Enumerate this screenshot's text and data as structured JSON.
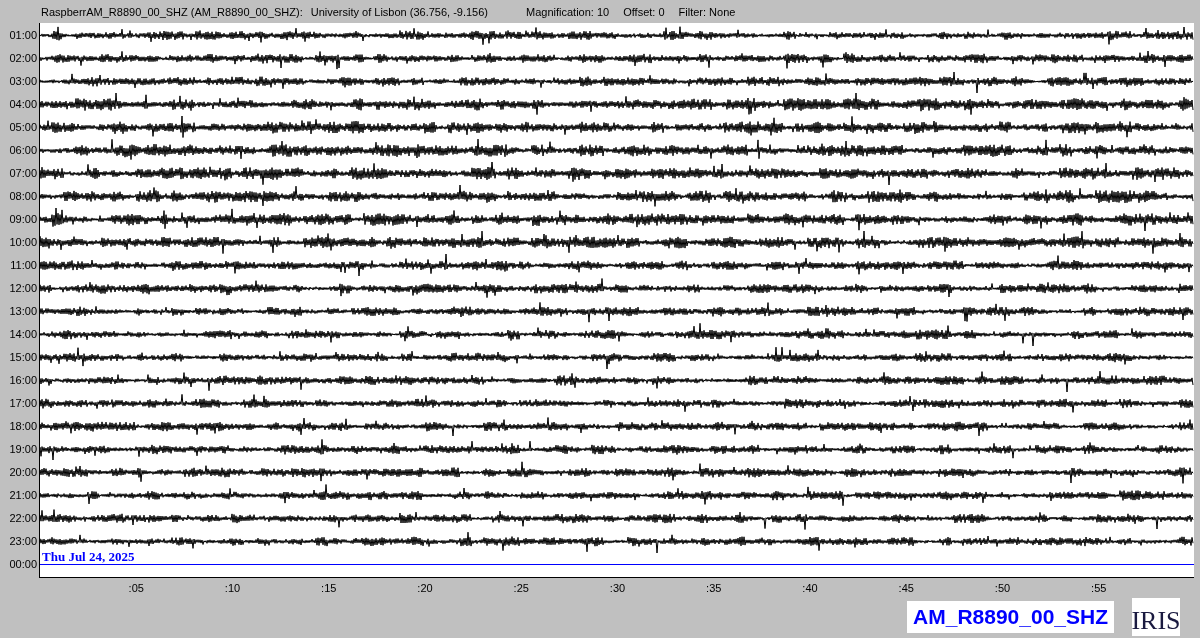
{
  "header": {
    "station": "RaspberrAM_R8890_00_SHZ (AM_R8890_00_SHZ):",
    "location": "University of Lisbon (36.756, -9.156)",
    "magnification": "Magnification: 10",
    "offset": "Offset: 0",
    "filter": "Filter: None"
  },
  "rows": [
    {
      "label": "01:00",
      "kind": "trace"
    },
    {
      "label": "02:00",
      "kind": "trace"
    },
    {
      "label": "03:00",
      "kind": "trace"
    },
    {
      "label": "04:00",
      "kind": "trace"
    },
    {
      "label": "05:00",
      "kind": "trace"
    },
    {
      "label": "06:00",
      "kind": "trace"
    },
    {
      "label": "07:00",
      "kind": "trace"
    },
    {
      "label": "08:00",
      "kind": "trace"
    },
    {
      "label": "09:00",
      "kind": "trace"
    },
    {
      "label": "10:00",
      "kind": "trace"
    },
    {
      "label": "11:00",
      "kind": "trace"
    },
    {
      "label": "12:00",
      "kind": "trace"
    },
    {
      "label": "13:00",
      "kind": "trace"
    },
    {
      "label": "14:00",
      "kind": "trace"
    },
    {
      "label": "15:00",
      "kind": "trace"
    },
    {
      "label": "16:00",
      "kind": "trace"
    },
    {
      "label": "17:00",
      "kind": "trace"
    },
    {
      "label": "18:00",
      "kind": "trace"
    },
    {
      "label": "19:00",
      "kind": "trace"
    },
    {
      "label": "20:00",
      "kind": "trace"
    },
    {
      "label": "21:00",
      "kind": "trace"
    },
    {
      "label": "22:00",
      "kind": "trace"
    },
    {
      "label": "23:00",
      "kind": "trace"
    },
    {
      "label": "00:00",
      "kind": "current"
    }
  ],
  "date_label": "Thu Jul 24, 2025",
  "minute_ticks": [
    ":05",
    ":10",
    ":15",
    ":20",
    ":25",
    ":30",
    ":35",
    ":40",
    ":45",
    ":50",
    ":55"
  ],
  "station_badge": "AM_R8890_00_SHZ",
  "logo": "IRIS"
}
